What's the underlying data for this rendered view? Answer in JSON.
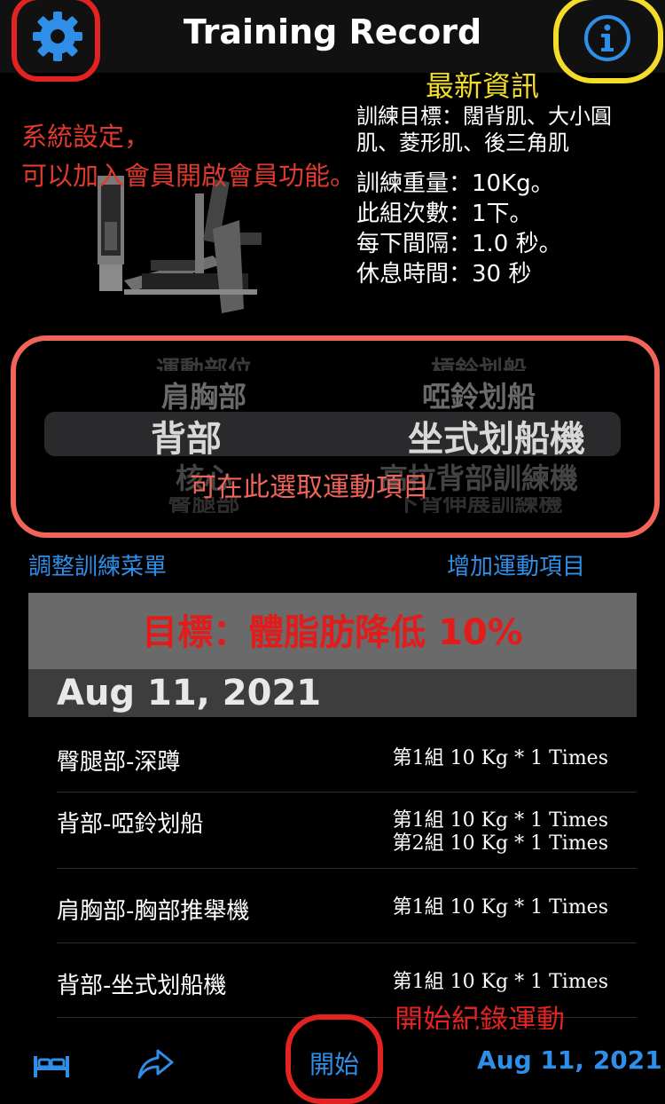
{
  "header": {
    "title": "Training Record"
  },
  "annotations": {
    "latest_info": "最新資訊",
    "settings": "系統設定，\n可以加入會員開啟會員功能。",
    "picker": "可在此選取運動項目",
    "start": "開始紀錄運動"
  },
  "info": {
    "target": "訓練目標：闊背肌、大小圓肌、菱形肌、後三角肌",
    "weight": "訓練重量：10Kg。",
    "reps": "此組次數：1下。",
    "interval": "每下間隔：1.0 秒。",
    "rest": "休息時間：30 秒"
  },
  "picker": {
    "left": {
      "far_top": "運動部位",
      "near_top": "肩胸部",
      "selected": "背部",
      "near_bottom": "核心",
      "far_bottom": "臀腿部"
    },
    "right": {
      "far_top": "槓鈴划船",
      "near_top": "啞鈴划船",
      "selected": "坐式划船機",
      "near_bottom": "高拉背部訓練機",
      "far_bottom": "下背伸展訓練機"
    }
  },
  "links": {
    "adjust_menu": "調整訓練菜單",
    "add_exercise": "增加運動項目"
  },
  "goal": "目標：體脂肪降低 10%",
  "section_date": "Aug 11, 2021",
  "records": [
    {
      "name": "臀腿部-深蹲",
      "sets": [
        "第1組  10 Kg * 1 Times"
      ]
    },
    {
      "name": "背部-啞鈴划船",
      "sets": [
        "第1組  10 Kg * 1 Times",
        "第2組  10 Kg * 1 Times"
      ]
    },
    {
      "name": "肩胸部-胸部推舉機",
      "sets": [
        "第1組  10 Kg * 1 Times"
      ]
    },
    {
      "name": "背部-坐式划船機",
      "sets": [
        "第1組  10 Kg * 1 Times"
      ]
    }
  ],
  "bottom": {
    "start": "開始",
    "date": "Aug 11, 2021"
  },
  "icons": {
    "settings": "gear-icon",
    "info": "info-icon",
    "bed": "bed-icon",
    "share": "share-icon"
  },
  "colors": {
    "accent": "#2f8fe8",
    "goal": "#e21b1b"
  }
}
